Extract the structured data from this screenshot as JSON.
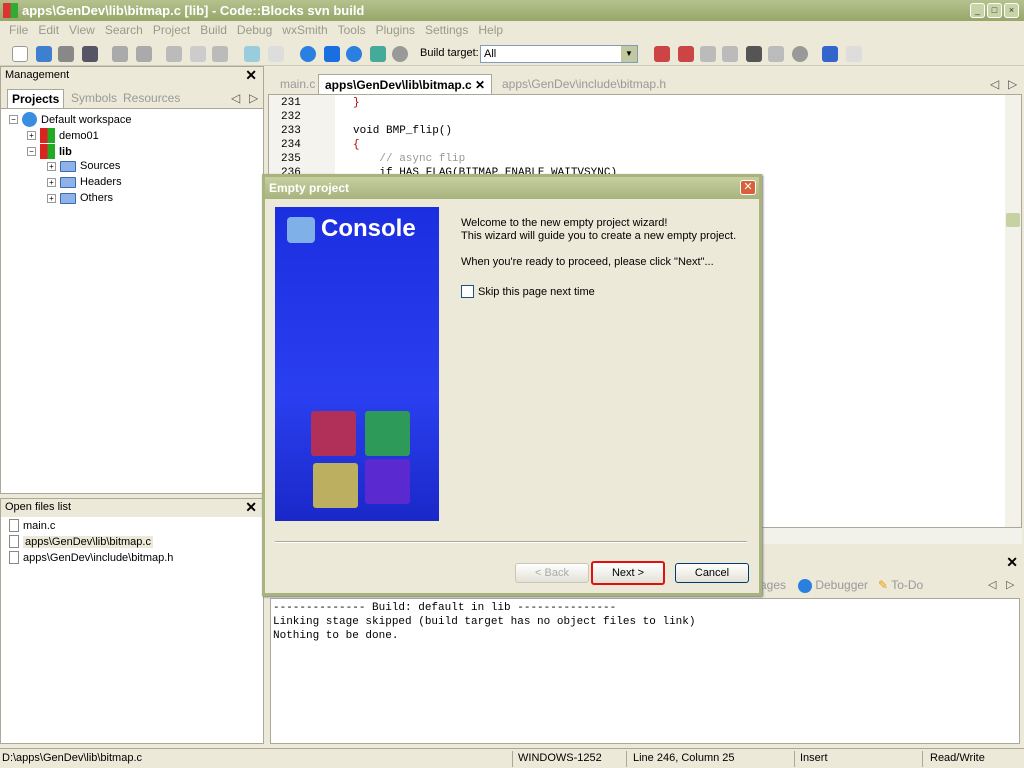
{
  "window": {
    "title": "apps\\GenDev\\lib\\bitmap.c [lib] - Code::Blocks svn build"
  },
  "menu": [
    "File",
    "Edit",
    "View",
    "Search",
    "Project",
    "Build",
    "Debug",
    "wxSmith",
    "Tools",
    "Plugins",
    "Settings",
    "Help"
  ],
  "toolbar": {
    "build_target_label": "Build target:",
    "build_target_value": "All"
  },
  "management": {
    "title": "Management",
    "tabs": [
      "Projects",
      "Symbols",
      "Resources"
    ],
    "tree": {
      "workspace": "Default workspace",
      "projects": [
        "demo01",
        "lib"
      ],
      "folders": [
        "Sources",
        "Headers",
        "Others"
      ]
    }
  },
  "open_files": {
    "title": "Open files list",
    "files": [
      "main.c",
      "apps\\GenDev\\lib\\bitmap.c",
      "apps\\GenDev\\include\\bitmap.h"
    ]
  },
  "editor": {
    "tabs": [
      "main.c",
      "apps\\GenDev\\lib\\bitmap.c",
      "apps\\GenDev\\include\\bitmap.h"
    ],
    "lines": [
      {
        "n": "231",
        "code": "}"
      },
      {
        "n": "232",
        "code": ""
      },
      {
        "n": "233",
        "code": "void BMP_flip()"
      },
      {
        "n": "234",
        "code": "{"
      },
      {
        "n": "235",
        "code": "    // async flip"
      },
      {
        "n": "236",
        "code": "    if HAS_FLAG(BITMAP_ENABLE_WAITVSYNC)"
      }
    ]
  },
  "log": {
    "tabs": [
      "ages",
      "Debugger",
      "To-Do"
    ],
    "lines": [
      "-------------- Build: default in lib ---------------",
      "Linking stage skipped (build target has no object files to link)",
      "Nothing to be done."
    ]
  },
  "status": {
    "path": "D:\\apps\\GenDev\\lib\\bitmap.c",
    "encoding": "WINDOWS-1252",
    "position": "Line 246, Column 25",
    "mode": "Insert",
    "access": "Read/Write"
  },
  "dialog": {
    "title": "Empty project",
    "banner": "Console",
    "line1": "Welcome to the new empty project wizard!",
    "line2": "This wizard will guide you to create a new empty project.",
    "line3": "When you're ready to proceed, please click \"Next\"...",
    "checkbox": "Skip this page next time",
    "checkbox_checked": false,
    "back": "< Back",
    "next": "Next >",
    "cancel": "Cancel"
  }
}
